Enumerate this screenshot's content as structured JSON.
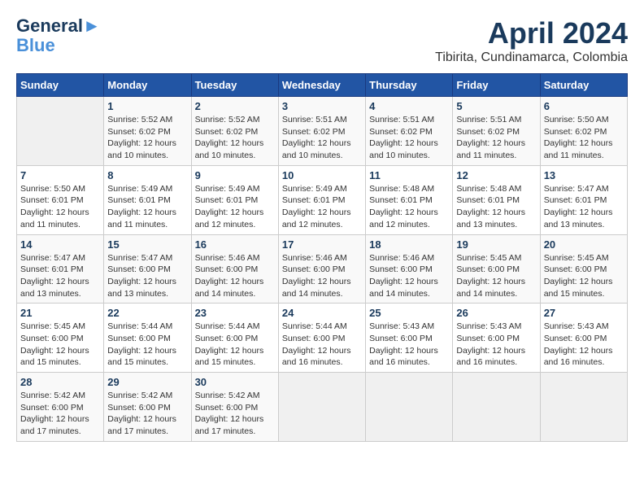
{
  "header": {
    "logo_line1": "General",
    "logo_line2": "Blue",
    "month_year": "April 2024",
    "location": "Tibirita, Cundinamarca, Colombia"
  },
  "days_of_week": [
    "Sunday",
    "Monday",
    "Tuesday",
    "Wednesday",
    "Thursday",
    "Friday",
    "Saturday"
  ],
  "weeks": [
    [
      {
        "day": "",
        "info": ""
      },
      {
        "day": "1",
        "info": "Sunrise: 5:52 AM\nSunset: 6:02 PM\nDaylight: 12 hours\nand 10 minutes."
      },
      {
        "day": "2",
        "info": "Sunrise: 5:52 AM\nSunset: 6:02 PM\nDaylight: 12 hours\nand 10 minutes."
      },
      {
        "day": "3",
        "info": "Sunrise: 5:51 AM\nSunset: 6:02 PM\nDaylight: 12 hours\nand 10 minutes."
      },
      {
        "day": "4",
        "info": "Sunrise: 5:51 AM\nSunset: 6:02 PM\nDaylight: 12 hours\nand 10 minutes."
      },
      {
        "day": "5",
        "info": "Sunrise: 5:51 AM\nSunset: 6:02 PM\nDaylight: 12 hours\nand 11 minutes."
      },
      {
        "day": "6",
        "info": "Sunrise: 5:50 AM\nSunset: 6:02 PM\nDaylight: 12 hours\nand 11 minutes."
      }
    ],
    [
      {
        "day": "7",
        "info": "Sunrise: 5:50 AM\nSunset: 6:01 PM\nDaylight: 12 hours\nand 11 minutes."
      },
      {
        "day": "8",
        "info": "Sunrise: 5:49 AM\nSunset: 6:01 PM\nDaylight: 12 hours\nand 11 minutes."
      },
      {
        "day": "9",
        "info": "Sunrise: 5:49 AM\nSunset: 6:01 PM\nDaylight: 12 hours\nand 12 minutes."
      },
      {
        "day": "10",
        "info": "Sunrise: 5:49 AM\nSunset: 6:01 PM\nDaylight: 12 hours\nand 12 minutes."
      },
      {
        "day": "11",
        "info": "Sunrise: 5:48 AM\nSunset: 6:01 PM\nDaylight: 12 hours\nand 12 minutes."
      },
      {
        "day": "12",
        "info": "Sunrise: 5:48 AM\nSunset: 6:01 PM\nDaylight: 12 hours\nand 13 minutes."
      },
      {
        "day": "13",
        "info": "Sunrise: 5:47 AM\nSunset: 6:01 PM\nDaylight: 12 hours\nand 13 minutes."
      }
    ],
    [
      {
        "day": "14",
        "info": "Sunrise: 5:47 AM\nSunset: 6:01 PM\nDaylight: 12 hours\nand 13 minutes."
      },
      {
        "day": "15",
        "info": "Sunrise: 5:47 AM\nSunset: 6:00 PM\nDaylight: 12 hours\nand 13 minutes."
      },
      {
        "day": "16",
        "info": "Sunrise: 5:46 AM\nSunset: 6:00 PM\nDaylight: 12 hours\nand 14 minutes."
      },
      {
        "day": "17",
        "info": "Sunrise: 5:46 AM\nSunset: 6:00 PM\nDaylight: 12 hours\nand 14 minutes."
      },
      {
        "day": "18",
        "info": "Sunrise: 5:46 AM\nSunset: 6:00 PM\nDaylight: 12 hours\nand 14 minutes."
      },
      {
        "day": "19",
        "info": "Sunrise: 5:45 AM\nSunset: 6:00 PM\nDaylight: 12 hours\nand 14 minutes."
      },
      {
        "day": "20",
        "info": "Sunrise: 5:45 AM\nSunset: 6:00 PM\nDaylight: 12 hours\nand 15 minutes."
      }
    ],
    [
      {
        "day": "21",
        "info": "Sunrise: 5:45 AM\nSunset: 6:00 PM\nDaylight: 12 hours\nand 15 minutes."
      },
      {
        "day": "22",
        "info": "Sunrise: 5:44 AM\nSunset: 6:00 PM\nDaylight: 12 hours\nand 15 minutes."
      },
      {
        "day": "23",
        "info": "Sunrise: 5:44 AM\nSunset: 6:00 PM\nDaylight: 12 hours\nand 15 minutes."
      },
      {
        "day": "24",
        "info": "Sunrise: 5:44 AM\nSunset: 6:00 PM\nDaylight: 12 hours\nand 16 minutes."
      },
      {
        "day": "25",
        "info": "Sunrise: 5:43 AM\nSunset: 6:00 PM\nDaylight: 12 hours\nand 16 minutes."
      },
      {
        "day": "26",
        "info": "Sunrise: 5:43 AM\nSunset: 6:00 PM\nDaylight: 12 hours\nand 16 minutes."
      },
      {
        "day": "27",
        "info": "Sunrise: 5:43 AM\nSunset: 6:00 PM\nDaylight: 12 hours\nand 16 minutes."
      }
    ],
    [
      {
        "day": "28",
        "info": "Sunrise: 5:42 AM\nSunset: 6:00 PM\nDaylight: 12 hours\nand 17 minutes."
      },
      {
        "day": "29",
        "info": "Sunrise: 5:42 AM\nSunset: 6:00 PM\nDaylight: 12 hours\nand 17 minutes."
      },
      {
        "day": "30",
        "info": "Sunrise: 5:42 AM\nSunset: 6:00 PM\nDaylight: 12 hours\nand 17 minutes."
      },
      {
        "day": "",
        "info": ""
      },
      {
        "day": "",
        "info": ""
      },
      {
        "day": "",
        "info": ""
      },
      {
        "day": "",
        "info": ""
      }
    ]
  ]
}
